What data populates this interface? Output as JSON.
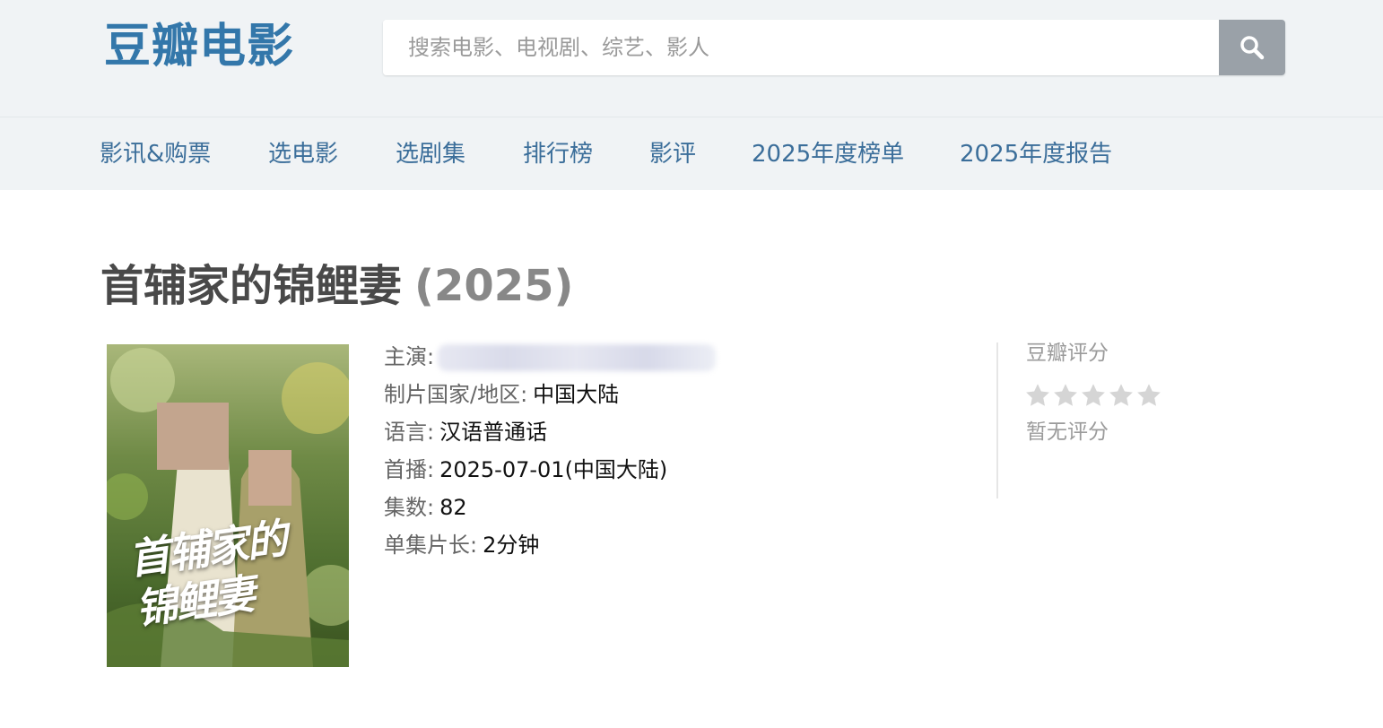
{
  "header": {
    "logo": "豆瓣电影",
    "search_placeholder": "搜索电影、电视剧、综艺、影人",
    "search_button_icon": "search-icon"
  },
  "nav": {
    "items": [
      {
        "label": "影讯&购票"
      },
      {
        "label": "选电影"
      },
      {
        "label": "选剧集"
      },
      {
        "label": "排行榜"
      },
      {
        "label": "影评"
      },
      {
        "label": "2025年度榜单"
      },
      {
        "label": "2025年度报告"
      }
    ]
  },
  "subject": {
    "title": "首辅家的锦鲤妻",
    "year": "(2025)",
    "poster": {
      "title_text": "首辅家的\n锦鲤妻",
      "image_icon": "poster-image"
    },
    "info": {
      "cast_label": "主演:",
      "country_label": "制片国家/地区:",
      "country_value": "中国大陆",
      "language_label": "语言:",
      "language_value": "汉语普通话",
      "premiere_label": "首播:",
      "premiere_value": "2025-07-01(中国大陆)",
      "episodes_label": "集数:",
      "episodes_value": "82",
      "runtime_label": "单集片长:",
      "runtime_value": "2分钟"
    },
    "rating": {
      "label": "豆瓣评分",
      "stars_filled": 0,
      "stars_total": 5,
      "no_rating_text": "暂无评分"
    }
  },
  "colors": {
    "brand": "#3377aa",
    "nav_link": "#3b6e9a",
    "header_bg": "#f0f3f5",
    "search_button": "#9aa1a8",
    "star_empty": "#d5d5d5"
  }
}
